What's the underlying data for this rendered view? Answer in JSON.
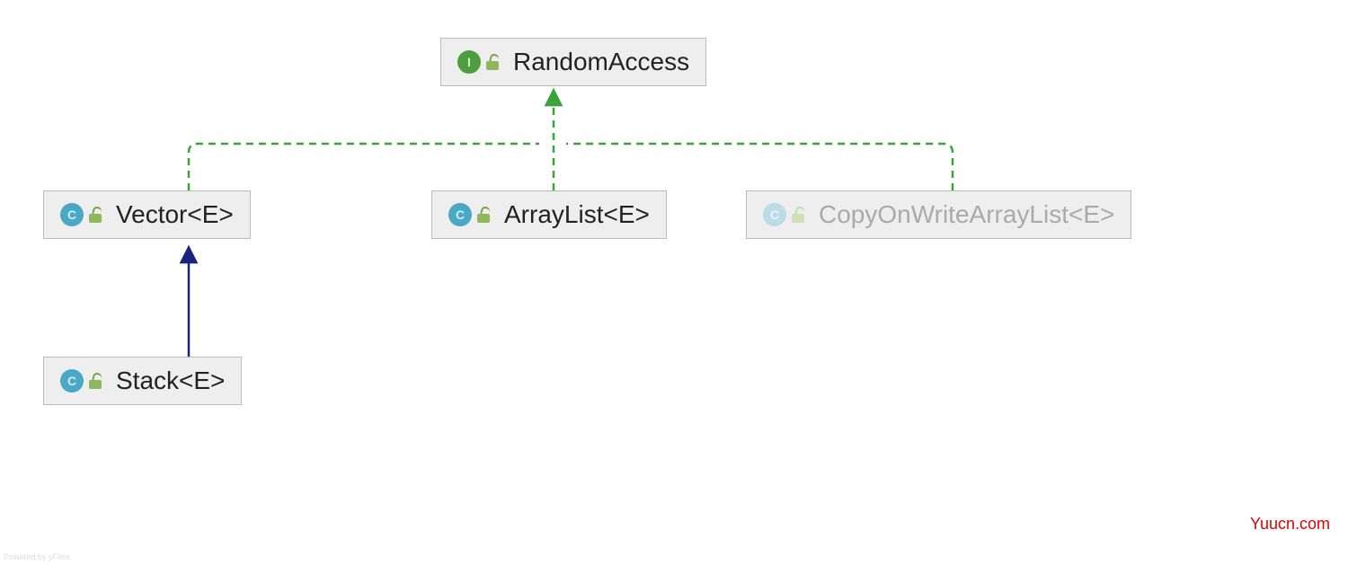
{
  "nodes": {
    "random_access": {
      "label": "RandomAccess",
      "badge_letter": "I",
      "kind": "interface"
    },
    "vector": {
      "label": "Vector<E>",
      "badge_letter": "C",
      "kind": "class"
    },
    "arraylist": {
      "label": "ArrayList<E>",
      "badge_letter": "C",
      "kind": "class"
    },
    "cowal": {
      "label": "CopyOnWriteArrayList<E>",
      "badge_letter": "C",
      "kind": "class"
    },
    "stack": {
      "label": "Stack<E>",
      "badge_letter": "C",
      "kind": "class"
    }
  },
  "edges": [
    {
      "from": "vector",
      "to": "random_access",
      "style": "dashed",
      "color": "#3aa33a"
    },
    {
      "from": "arraylist",
      "to": "random_access",
      "style": "dashed",
      "color": "#3aa33a"
    },
    {
      "from": "cowal",
      "to": "random_access",
      "style": "dashed",
      "color": "#3aa33a"
    },
    {
      "from": "stack",
      "to": "vector",
      "style": "solid",
      "color": "#1a237e"
    }
  ],
  "watermark": "Yuucn.com",
  "powered_by": "Powered by yFiles"
}
